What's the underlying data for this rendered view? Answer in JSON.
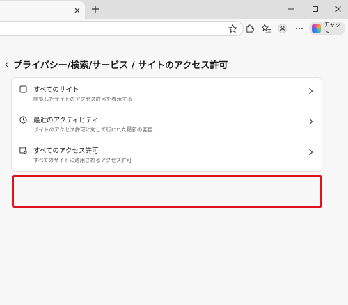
{
  "browser": {
    "tab_close_icon": "close-icon",
    "new_tab_icon": "plus-icon",
    "window_controls": [
      "minimize-icon",
      "maximize-icon",
      "close-icon"
    ],
    "toolbar_icons": [
      "favorite-star-icon",
      "extensions-icon",
      "favorites-list-icon",
      "profile-icon",
      "more-icon"
    ],
    "copilot_label": "チャット"
  },
  "page": {
    "back_icon": "chevron-left-icon",
    "title": "プライバシー/検索/サービス / サイトのアクセス許可"
  },
  "items": [
    {
      "icon": "site-page-icon",
      "title": "すべてのサイト",
      "subtitle": "閲覧したサイトのアクセス許可を表示する",
      "chevron": "chevron-right-icon"
    },
    {
      "icon": "clock-icon",
      "title": "最近のアクティビティ",
      "subtitle": "サイトのアクセス許可に対して行われた最新の変更",
      "chevron": "chevron-right-icon"
    },
    {
      "icon": "permissions-icon",
      "title": "すべてのアクセス許可",
      "subtitle": "すべてのサイトに適用されるアクセス許可",
      "chevron": "chevron-right-icon",
      "highlighted": true
    }
  ],
  "colors": {
    "highlight": "#e0101e",
    "chrome": "#dfdfdf",
    "background": "#f7f7f7"
  }
}
